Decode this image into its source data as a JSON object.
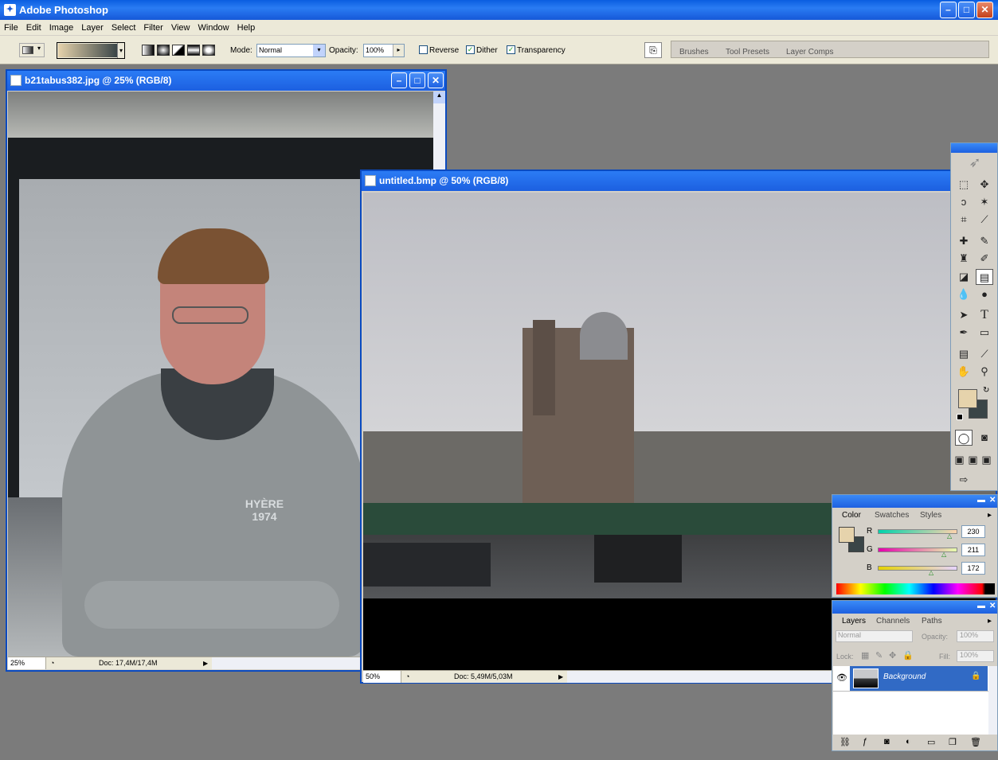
{
  "app": {
    "title": "Adobe Photoshop"
  },
  "menu": [
    "File",
    "Edit",
    "Image",
    "Layer",
    "Select",
    "Filter",
    "View",
    "Window",
    "Help"
  ],
  "options": {
    "mode_label": "Mode:",
    "mode_value": "Normal",
    "opacity_label": "Opacity:",
    "opacity_value": "100%",
    "reverse_label": "Reverse",
    "dither_label": "Dither",
    "transparency_label": "Transparency",
    "reverse_checked": false,
    "dither_checked": true,
    "transparency_checked": true,
    "gradient_from": "#e6d3ac",
    "gradient_to": "#3a4547"
  },
  "palette_well": {
    "tabs": [
      "Brushes",
      "Tool Presets",
      "Layer Comps"
    ]
  },
  "doc1": {
    "title": "b21tabus382.jpg @ 25% (RGB/8)",
    "zoom": "25%",
    "doc_size": "Doc: 17,4M/17,4M"
  },
  "doc2": {
    "title": "untitled.bmp @ 50% (RGB/8)",
    "zoom": "50%",
    "doc_size": "Doc: 5,49M/5,03M"
  },
  "color_panel": {
    "tabs": [
      "Color",
      "Swatches",
      "Styles"
    ],
    "r_label": "R",
    "g_label": "G",
    "b_label": "B",
    "r": "230",
    "g": "211",
    "b": "172",
    "foreground": "#e6d3ac",
    "background": "#3a4547"
  },
  "layers_panel": {
    "tabs": [
      "Layers",
      "Channels",
      "Paths"
    ],
    "blend_mode": "Normal",
    "opacity_label": "Opacity:",
    "opacity_value": "100%",
    "lock_label": "Lock:",
    "fill_label": "Fill:",
    "fill_value": "100%",
    "layers": [
      {
        "name": "Background",
        "visible": true,
        "locked": true
      }
    ]
  }
}
